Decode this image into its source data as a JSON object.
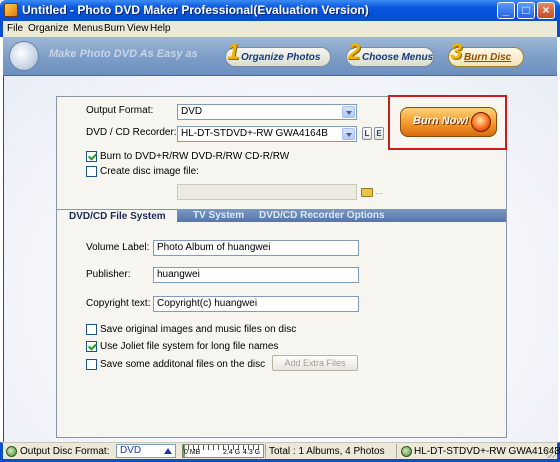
{
  "window": {
    "title": "Untitled - Photo DVD Maker Professional(Evaluation Version)",
    "controls": [
      "_",
      "□",
      "×"
    ]
  },
  "menu": [
    "File",
    "Organize",
    "Menus",
    "Burn",
    "View",
    "Help"
  ],
  "banner": {
    "slogan": "Make Photo DVD As Easy as",
    "steps": [
      {
        "num": "1",
        "label": "Organize Photos"
      },
      {
        "num": "2",
        "label": "Choose Menus"
      },
      {
        "num": "3",
        "label": "Burn Disc"
      }
    ],
    "active_step": 3
  },
  "settings": {
    "output_format_label": "Output Format:",
    "output_format_value": "DVD",
    "recorder_label": "DVD / CD Recorder:",
    "recorder_value": "HL-DT-STDVD+-RW GWA4164B",
    "recorder_btn_l": "L",
    "recorder_btn_e": "E",
    "burn_to_disc_label": "Burn to DVD+R/RW DVD-R/RW  CD-R/RW",
    "burn_to_disc_checked": true,
    "create_image_label": "Create disc image file:",
    "create_image_checked": false,
    "image_path_value": "",
    "browse_dots": "...",
    "burn_now_label": "Burn Now!"
  },
  "tabs": [
    {
      "label": "DVD/CD File System",
      "active": true
    },
    {
      "label": "TV System",
      "active": false
    },
    {
      "label": "DVD/CD Recorder Options",
      "active": false
    }
  ],
  "filesystem": {
    "volume_label_label": "Volume Label:",
    "volume_label_value": "Photo Album of huangwei",
    "publisher_label": "Publisher:",
    "publisher_value": "huangwei",
    "copyright_label": "Copyright text:",
    "copyright_value": "Copyright(c) huangwei",
    "opt_save_originals": "Save original images and music files on disc",
    "opt_save_originals_checked": false,
    "opt_joliet": "Use Joliet file system for long file names",
    "opt_joliet_checked": true,
    "opt_additional": "Save some additonal files on the disc",
    "opt_additional_checked": false,
    "add_extra_files_label": "Add Extra Files"
  },
  "status": {
    "output_disc_format_label": "Output Disc Format:",
    "output_disc_format_value": "DVD",
    "gauge_labels": [
      "0 MB",
      "2.4 G",
      "4.3 G"
    ],
    "gauge_fraction": 0.02,
    "summary": "Total : 1 Albums, 4 Photos",
    "drive": "HL-DT-STDVD+-RW GWA4164B"
  },
  "colors": {
    "titlebar": "#0450d8",
    "highlight_frame": "#cc1c1c",
    "tab_strip": "#5676a8",
    "burn_button": "#f39a2a"
  }
}
